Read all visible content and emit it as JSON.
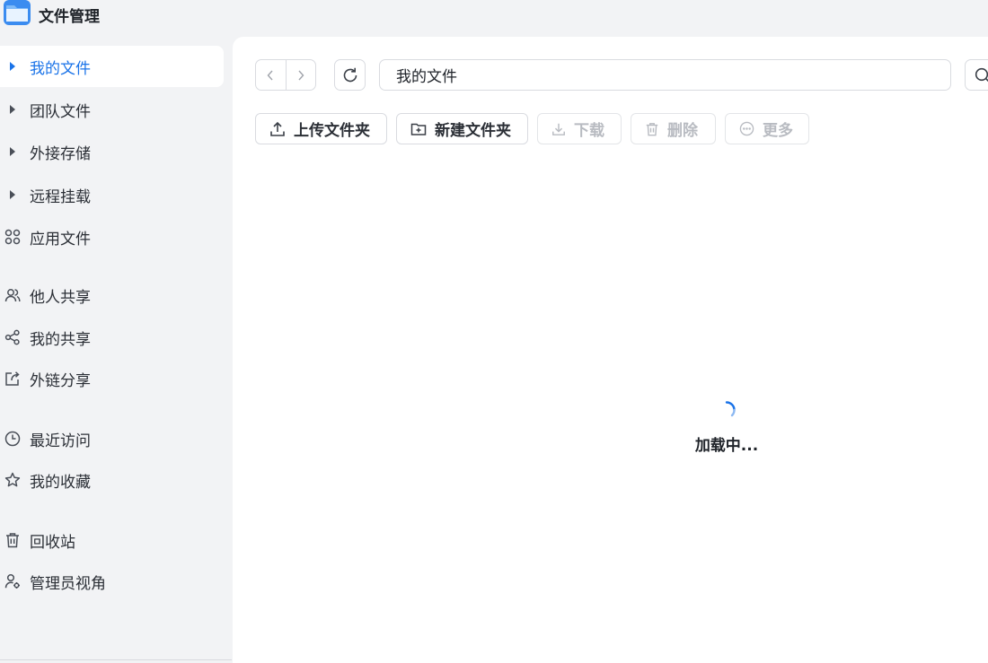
{
  "app": {
    "title": "文件管理"
  },
  "sidebar": {
    "items": [
      {
        "label": "我的文件",
        "icon": "caret-right-icon",
        "active": true
      },
      {
        "label": "团队文件",
        "icon": "caret-right-icon"
      },
      {
        "label": "外接存储",
        "icon": "caret-right-icon"
      },
      {
        "label": "远程挂载",
        "icon": "caret-right-icon"
      },
      {
        "label": "应用文件",
        "icon": "apps-grid-icon"
      },
      {
        "label": "他人共享",
        "icon": "users-icon"
      },
      {
        "label": "我的共享",
        "icon": "share-icon"
      },
      {
        "label": "外链分享",
        "icon": "external-link-icon"
      },
      {
        "label": "最近访问",
        "icon": "clock-icon"
      },
      {
        "label": "我的收藏",
        "icon": "star-icon"
      },
      {
        "label": "回收站",
        "icon": "trash-icon"
      },
      {
        "label": "管理员视角",
        "icon": "admin-user-icon"
      }
    ]
  },
  "path": {
    "value": "我的文件"
  },
  "toolbar": {
    "upload_folder": "上传文件夹",
    "new_folder": "新建文件夹",
    "download": "下载",
    "delete": "删除",
    "more": "更多"
  },
  "status": {
    "loading": "加载中..."
  },
  "colors": {
    "accent": "#1a73e8",
    "sidebar_bg": "#f2f3f5",
    "panel_bg": "#ffffff",
    "disabled": "#b8bbc1"
  }
}
